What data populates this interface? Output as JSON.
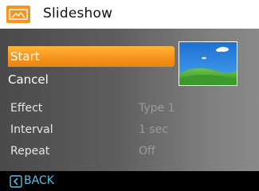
{
  "header": {
    "title": "Slideshow",
    "icon": "slideshow-mode-icon",
    "icon_color": "#f7941d"
  },
  "menu": {
    "items": [
      {
        "label": "Start",
        "selected": true,
        "highlight_color": "#f7941d"
      },
      {
        "label": "Cancel",
        "selected": false
      }
    ]
  },
  "settings": [
    {
      "label": "Effect",
      "value": "Type 1"
    },
    {
      "label": "Interval",
      "value": "1 sec"
    },
    {
      "label": "Repeat",
      "value": "Off"
    }
  ],
  "preview": {
    "icon": "landscape-thumbnail-icon"
  },
  "footer": {
    "back_label": "BACK",
    "back_icon": "back-arrow-icon",
    "accent_color": "#4ec3e8"
  }
}
